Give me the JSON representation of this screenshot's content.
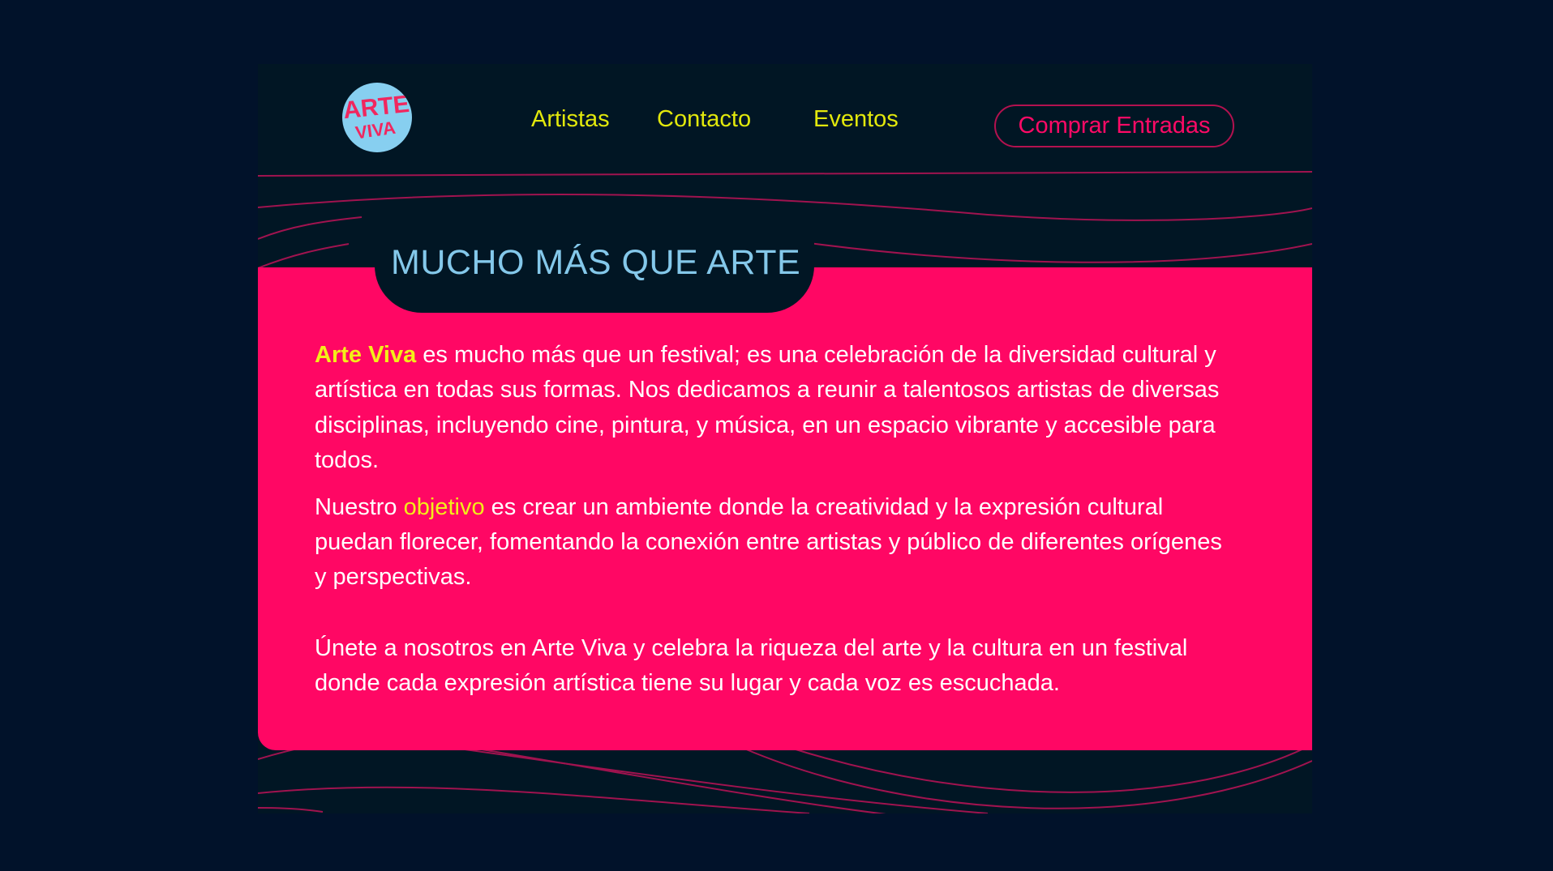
{
  "brand": {
    "logo_text_line1": "ARTE",
    "logo_text_line2": "VIVA"
  },
  "nav": {
    "items": [
      {
        "label": "Artistas"
      },
      {
        "label": "Contacto"
      },
      {
        "label": "Eventos"
      }
    ],
    "cta_label": "Comprar Entradas"
  },
  "main": {
    "title": "MUCHO MÁS QUE ARTE",
    "p1": {
      "highlight": "Arte Viva",
      "text": " es mucho más que un festival; es una celebración de la diversidad cultural y artística en todas sus formas. Nos dedicamos a reunir a talentosos artistas de diversas disciplinas, incluyendo cine, pintura, y música, en un espacio vibrante y accesible para todos."
    },
    "p2": {
      "before": "Nuestro ",
      "highlight": "objetivo",
      "after": " es crear un ambiente donde la creatividad y la expresión cultural puedan florecer, fomentando la conexión entre artistas y público de diferentes orígenes y perspectivas."
    },
    "p3": "Únete a nosotros en Arte Viva y celebra la riqueza del arte y la cultura en un festival donde cada expresión artística tiene su lugar y cada voz es escuchada."
  },
  "colors": {
    "background": "#01122a",
    "panel": "#011624",
    "accent_pink": "#ff0764",
    "nav_yellow": "#e2e80c",
    "title_blue": "#84c8ea"
  }
}
